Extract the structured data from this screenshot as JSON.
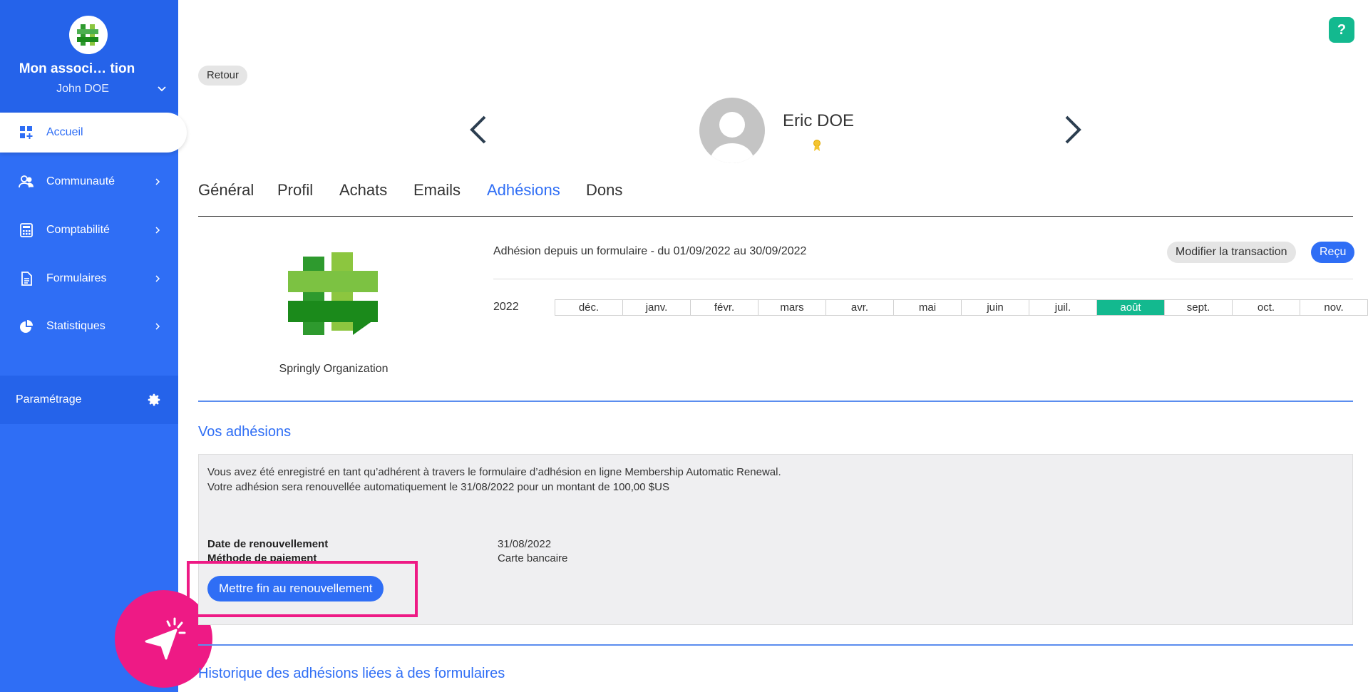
{
  "sidebar": {
    "org_name": "Mon associ… tion",
    "user_name": "John DOE",
    "items": [
      {
        "label": "Accueil"
      },
      {
        "label": "Communauté"
      },
      {
        "label": "Comptabilité"
      },
      {
        "label": "Formulaires"
      },
      {
        "label": "Statistiques"
      }
    ],
    "settings_label": "Paramétrage"
  },
  "help_label": "?",
  "back_label": "Retour",
  "person": {
    "name": "Eric DOE"
  },
  "tabs": [
    {
      "label": "Général"
    },
    {
      "label": "Profil"
    },
    {
      "label": "Achats"
    },
    {
      "label": "Emails"
    },
    {
      "label": "Adhésions"
    },
    {
      "label": "Dons"
    }
  ],
  "active_tab": "Adhésions",
  "organization": {
    "name": "Springly Organization"
  },
  "membership": {
    "description": "Adhésion depuis un formulaire - du 01/09/2022 au 30/09/2022",
    "modify_label": "Modifier la transaction",
    "receipt_label": "Reçu",
    "year": "2022",
    "months": [
      "déc.",
      "janv.",
      "févr.",
      "mars",
      "avr.",
      "mai",
      "juin",
      "juil.",
      "août",
      "sept.",
      "oct.",
      "nov."
    ],
    "active_month": "août"
  },
  "your_memberships": {
    "title": "Vos adhésions",
    "line1": "Vous avez été enregistré en tant qu’adhérent à travers le formulaire d’adhésion en ligne Membership Automatic Renewal.",
    "line2": "Votre adhésion sera renouvellée automatiquement le 31/08/2022 pour un montant de 100,00 $US",
    "renewal_date_label": "Date de renouvellement",
    "renewal_date_value": "31/08/2022",
    "payment_method_label": "Méthode de paiement",
    "payment_method_value": "Carte bancaire",
    "stop_button_label": "Mettre fin au renouvellement"
  },
  "history": {
    "title": "Historique des adhésions liées à des formulaires"
  },
  "colors": {
    "primary": "#2f6ef5",
    "sidebar": "#2f6ef5",
    "accent_green": "#13b98f",
    "highlight_pink": "#ee1a85"
  }
}
